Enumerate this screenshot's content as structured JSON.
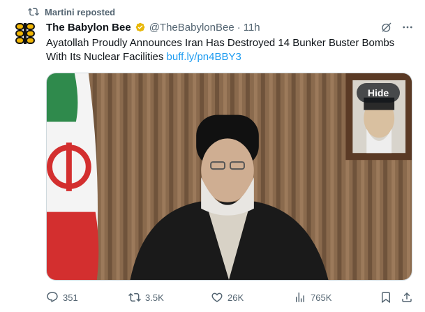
{
  "repost": {
    "label": "Martini reposted",
    "icon": "repost-icon"
  },
  "author": {
    "display_name": "The Babylon Bee",
    "handle": "@TheBabylonBee",
    "separator": "·",
    "time": "11h",
    "verified_color": "#e8b80b"
  },
  "tweet": {
    "text": "Ayatollah Proudly Announces Iran Has Destroyed 14 Bunker Buster Bombs With Its Nuclear Facilities ",
    "link": "buff.ly/pn4BBY3"
  },
  "media": {
    "hide_label": "Hide"
  },
  "actions": {
    "replies": "351",
    "reposts": "3.5K",
    "likes": "26K",
    "views": "765K"
  },
  "colors": {
    "link": "#1d9bf0",
    "muted": "#536471",
    "text": "#0f1419"
  }
}
